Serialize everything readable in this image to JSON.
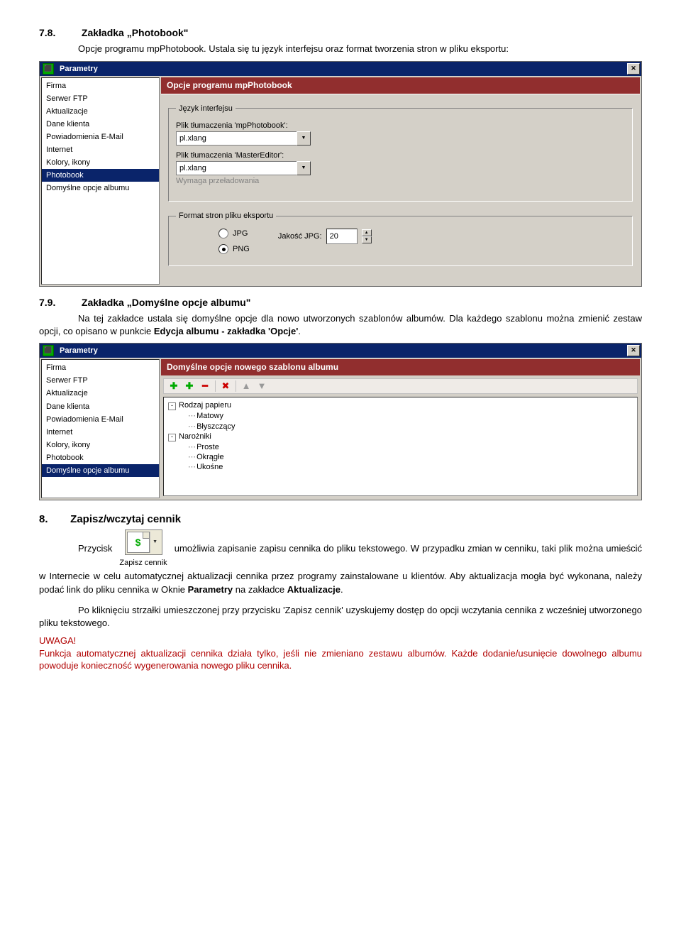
{
  "doc": {
    "s78": {
      "index": "7.8.",
      "title": "Zakładka „Photobook\"",
      "para1_a": "Opcje programu mpPhotobook. Ustala się tu język interfejsu oraz format tworzenia stron w pliku eksportu:",
      "para1_b": "w pliku eksportu:"
    },
    "s79": {
      "index": "7.9.",
      "title": "Zakładka „Domyślne opcje albumu\"",
      "para1": "Na tej zakładce ustala się domyślne opcje dla nowo utworzonych szablonów albumów. Dla każdego szablonu można zmienić zestaw opcji, co opisano w punkcie ",
      "para1_b": "Edycja albumu - zakładka 'Opcje'",
      "para1_c": "."
    },
    "s8": {
      "index": "8.",
      "title": "Zapisz/wczytaj cennik",
      "btn_label": "Zapisz cennik",
      "para1_lead": "Przycisk",
      "para1_rest": " umożliwia zapisanie zapisu cennika do pliku tekstowego. W przypadku zmian w cenniku, taki plik można umieścić w Internecie w celu automatycznej aktualizacji cennika przez programy zainstalowane u klientów. Aby aktualizacja mogła być wykonana, należy podać link do pliku cennika w Oknie ",
      "para1_b1": "Parametry",
      "para1_mid": " na zakładce ",
      "para1_b2": "Aktualizacje",
      "para1_end": ".",
      "para2": "Po kliknięciu strzałki umieszczonej przy przycisku 'Zapisz cennik' uzyskujemy dostęp do opcji wczytania cennika z wcześniej utworzonego pliku tekstowego.",
      "warn_head": "UWAGA!",
      "warn_body": "Funkcja automatycznej aktualizacji cennika działa tylko, jeśli nie zmieniano zestawu albumów. Każde dodanie/usunięcie dowolnego albumu powoduje konieczność wygenerowania nowego pliku cennika."
    }
  },
  "dialog1": {
    "title": "Parametry",
    "nav": [
      "Firma",
      "Serwer FTP",
      "Aktualizacje",
      "Dane klienta",
      "Powiadomienia E-Mail",
      "Internet",
      "Kolory, ikony",
      "Photobook",
      "Domyślne opcje albumu"
    ],
    "selected": "Photobook",
    "header": "Opcje programu mpPhotobook",
    "group_lang": {
      "legend": "Język interfejsu",
      "label1": "Plik tłumaczenia 'mpPhotobook':",
      "value1": "pl.xlang",
      "label2": "Plik tłumaczenia 'MasterEditor':",
      "value2": "pl.xlang",
      "note": "Wymaga przeładowania"
    },
    "group_export": {
      "legend": "Format stron pliku eksportu",
      "opt_jpg": "JPG",
      "opt_png": "PNG",
      "selected": "PNG",
      "quality_label": "Jakość JPG:",
      "quality_value": "20"
    }
  },
  "dialog2": {
    "title": "Parametry",
    "nav": [
      "Firma",
      "Serwer FTP",
      "Aktualizacje",
      "Dane klienta",
      "Powiadomienia E-Mail",
      "Internet",
      "Kolory, ikony",
      "Photobook",
      "Domyślne opcje albumu"
    ],
    "selected": "Domyślne opcje albumu",
    "header": "Domyślne opcje nowego szablonu albumu",
    "toolbar_icons": [
      "add-icon",
      "remove-icon",
      "delete-icon",
      "up-icon",
      "down-icon"
    ],
    "tree": [
      {
        "label": "Rodzaj papieru",
        "type": "root",
        "children": [
          "Matowy",
          "Błyszczący"
        ]
      },
      {
        "label": "Narożniki",
        "type": "root",
        "children": [
          "Proste",
          "Okrągłe",
          "Ukośne"
        ]
      }
    ]
  }
}
